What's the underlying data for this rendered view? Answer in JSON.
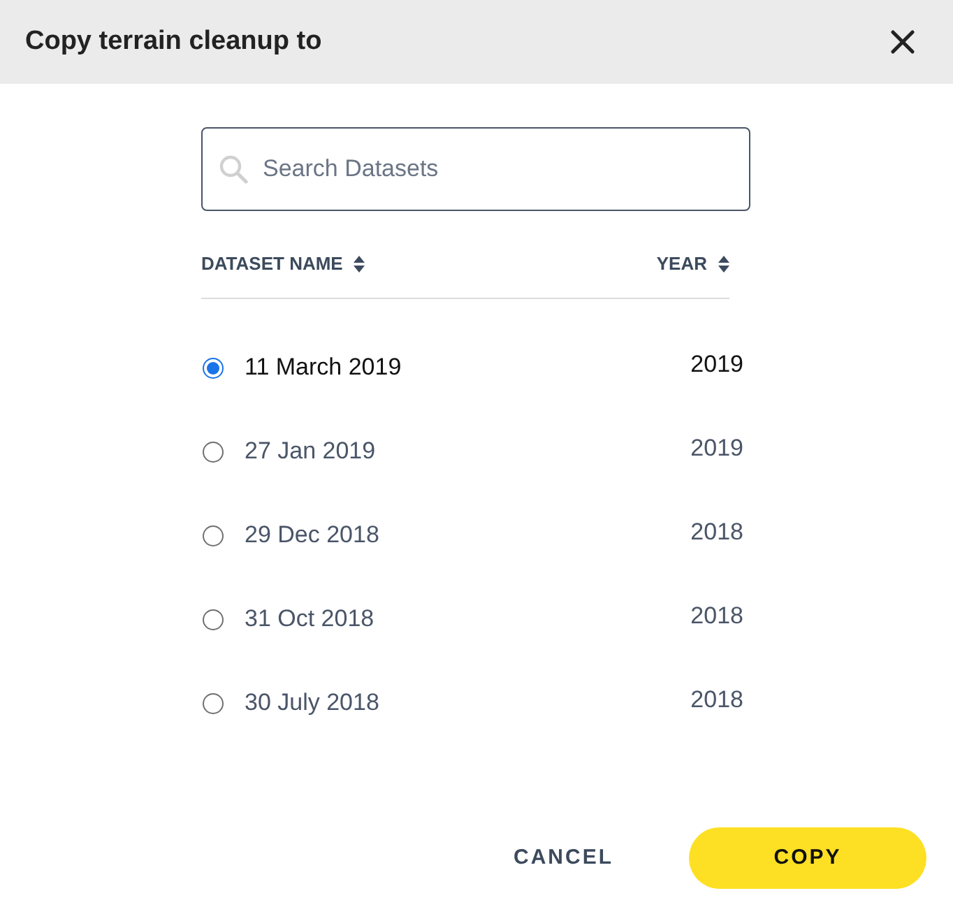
{
  "dialog": {
    "title": "Copy terrain cleanup to"
  },
  "search": {
    "placeholder": "Search Datasets"
  },
  "table": {
    "columns": [
      "DATASET NAME",
      "YEAR"
    ],
    "rows": [
      {
        "name": "11 March 2019",
        "year": "2019",
        "selected": true
      },
      {
        "name": "27 Jan 2019",
        "year": "2019",
        "selected": false
      },
      {
        "name": "29 Dec 2018",
        "year": "2018",
        "selected": false
      },
      {
        "name": "31 Oct 2018",
        "year": "2018",
        "selected": false
      },
      {
        "name": "30 July 2018",
        "year": "2018",
        "selected": false
      }
    ]
  },
  "buttons": [
    {
      "kind": "text",
      "label": "CANCEL"
    },
    {
      "kind": "primary",
      "label": "COPY"
    }
  ]
}
